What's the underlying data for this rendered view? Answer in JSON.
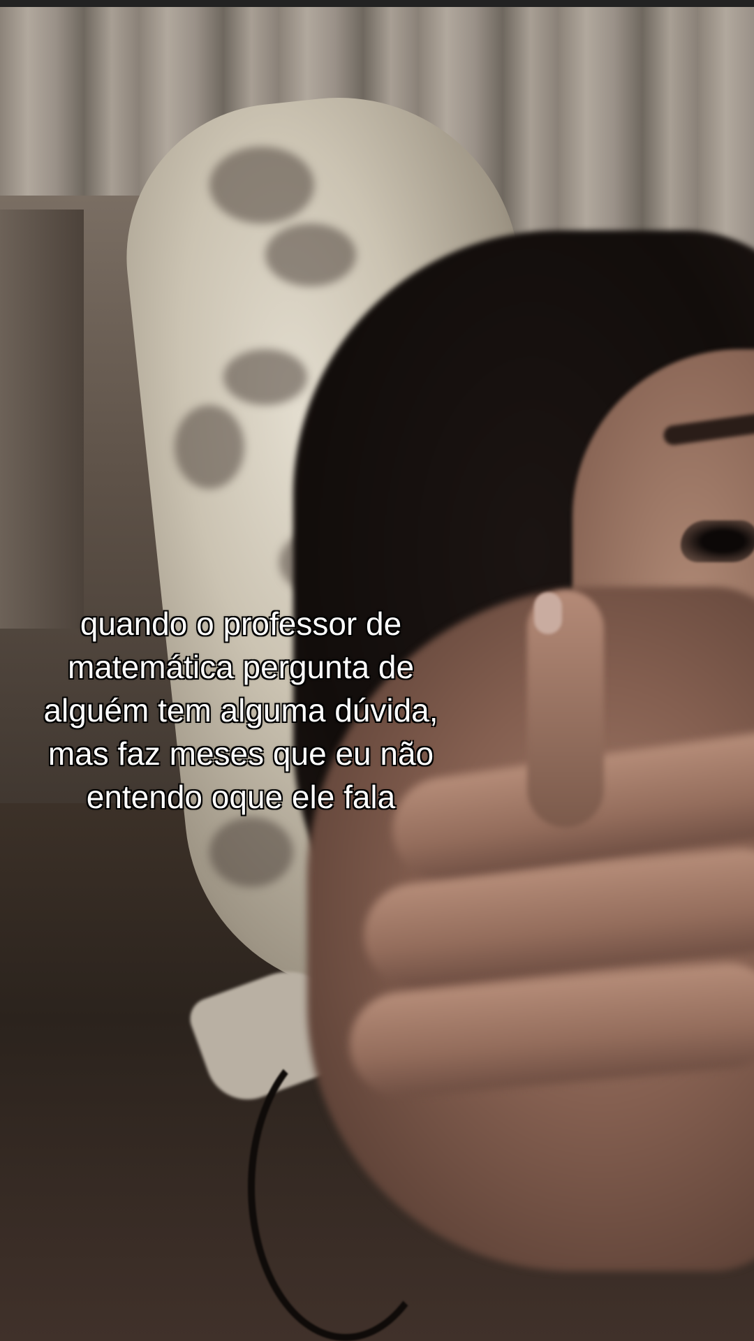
{
  "caption": {
    "lines": [
      "quando o professor de",
      "matemática pergunta de",
      "alguém tem alguma dúvida,",
      "mas faz meses que eu não",
      "entendo oque ele fala"
    ]
  }
}
